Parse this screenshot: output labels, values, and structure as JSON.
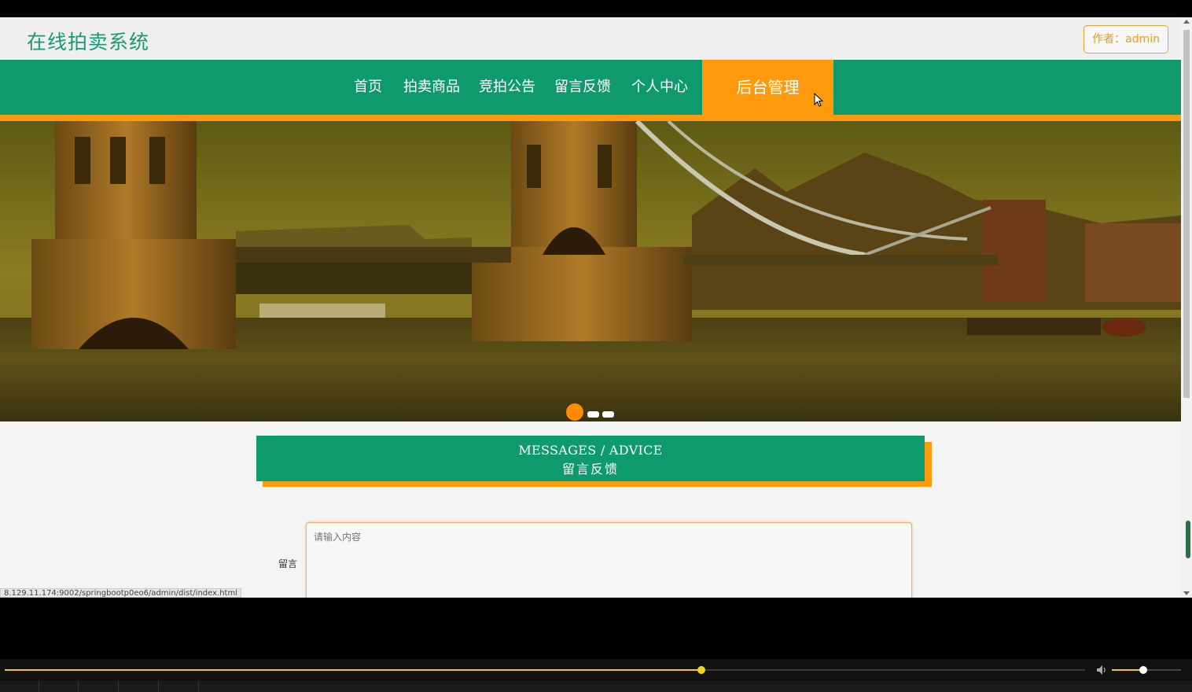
{
  "site": {
    "title": "在线拍卖系统",
    "author_badge": "作者：admin"
  },
  "nav": {
    "items": [
      {
        "label": "首页"
      },
      {
        "label": "拍卖商品"
      },
      {
        "label": "竞拍公告"
      },
      {
        "label": "留言反馈"
      },
      {
        "label": "个人中心"
      },
      {
        "label": "后台管理",
        "active": true
      }
    ]
  },
  "carousel": {
    "active_index": 0,
    "count": 3
  },
  "section": {
    "title_en": "MESSAGES / ADVICE",
    "title_cn": "留言反馈"
  },
  "form": {
    "message_label": "留言",
    "message_placeholder": "请输入内容"
  },
  "status_bar": {
    "url": "8.129.11.174:9002/springbootp0eo6/admin/dist/index.html"
  },
  "player": {
    "progress": 0.645,
    "volume": 0.45
  },
  "colors": {
    "primary_green": "#0f9a6e",
    "accent_orange": "#ff9a0e",
    "title_green": "#1a9a72"
  }
}
